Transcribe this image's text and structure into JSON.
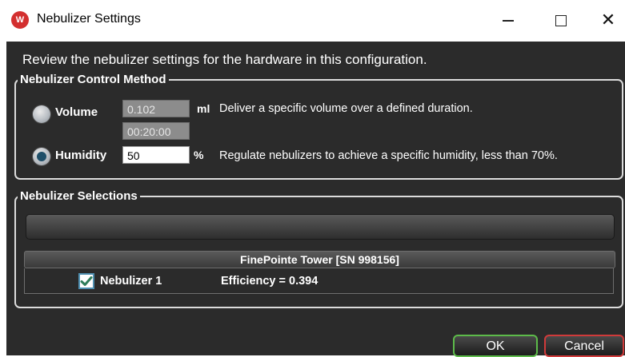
{
  "window": {
    "title": "Nebulizer Settings",
    "icon": "W",
    "close_glyph": "✕"
  },
  "intro_text": "Review the nebulizer settings for the hardware in this configuration.",
  "control_method": {
    "legend": "Nebulizer Control Method",
    "volume": {
      "label": "Volume",
      "selected": false,
      "value": "0.102",
      "unit": "ml",
      "duration": "00:20:00",
      "description": "Deliver a specific volume over a defined duration."
    },
    "humidity": {
      "label": "Humidity",
      "selected": true,
      "value": "50",
      "unit": "%",
      "description": "Regulate nebulizers to achieve a specific humidity, less than 70%."
    }
  },
  "selections": {
    "legend": "Nebulizer Selections",
    "device_header": "FinePointe Tower [SN 998156]",
    "nebulizers": [
      {
        "name": "Nebulizer 1",
        "checked": true,
        "efficiency": "Efficiency = 0.394"
      }
    ]
  },
  "buttons": {
    "ok": "OK",
    "cancel": "Cancel"
  },
  "colors": {
    "dialog_bg": "#2b2b2b",
    "ok_border": "#5dbb4a",
    "cancel_border": "#d03a3a",
    "checkbox_accent": "#4f8fb0"
  }
}
